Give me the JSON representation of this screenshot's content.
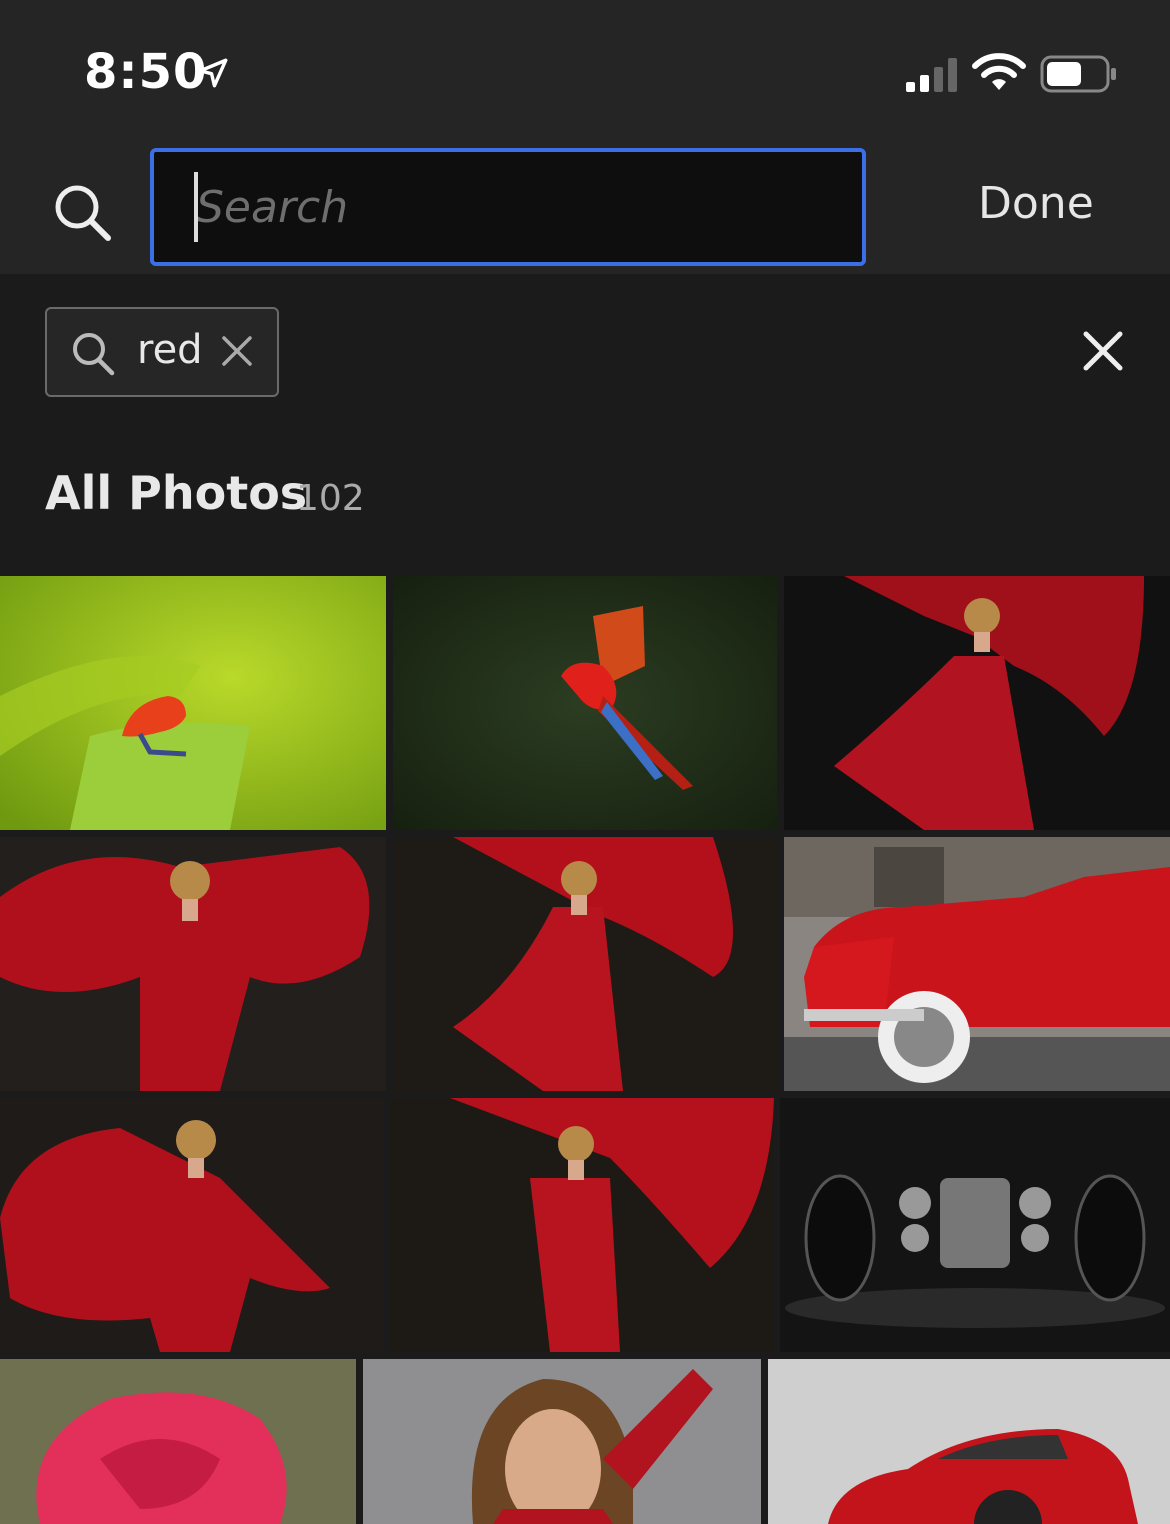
{
  "status_bar": {
    "time": "8:50",
    "icons": [
      "location-arrow-icon",
      "cellular-signal-icon",
      "wifi-icon",
      "battery-icon"
    ]
  },
  "search": {
    "placeholder": "Search",
    "value": "",
    "done_label": "Done"
  },
  "filters": {
    "chips": [
      {
        "label": "red"
      }
    ]
  },
  "section": {
    "title": "All Photos",
    "count": "102"
  },
  "photos": [
    {
      "subject": "red frog on green leaf"
    },
    {
      "subject": "scarlet macaw flying"
    },
    {
      "subject": "woman in red dress"
    },
    {
      "subject": "woman in red dress with billowing fabric"
    },
    {
      "subject": "woman in red dress"
    },
    {
      "subject": "red vintage convertible car"
    },
    {
      "subject": "woman in red dress with fabric"
    },
    {
      "subject": "woman in red dress"
    },
    {
      "subject": "black and white hot rod car"
    },
    {
      "subject": "red rose"
    },
    {
      "subject": "woman in red top portrait"
    },
    {
      "subject": "red sports car"
    }
  ],
  "colors": {
    "accent": "#3b6fe6",
    "background": "#1b1b1b",
    "header_bg": "#252525"
  }
}
